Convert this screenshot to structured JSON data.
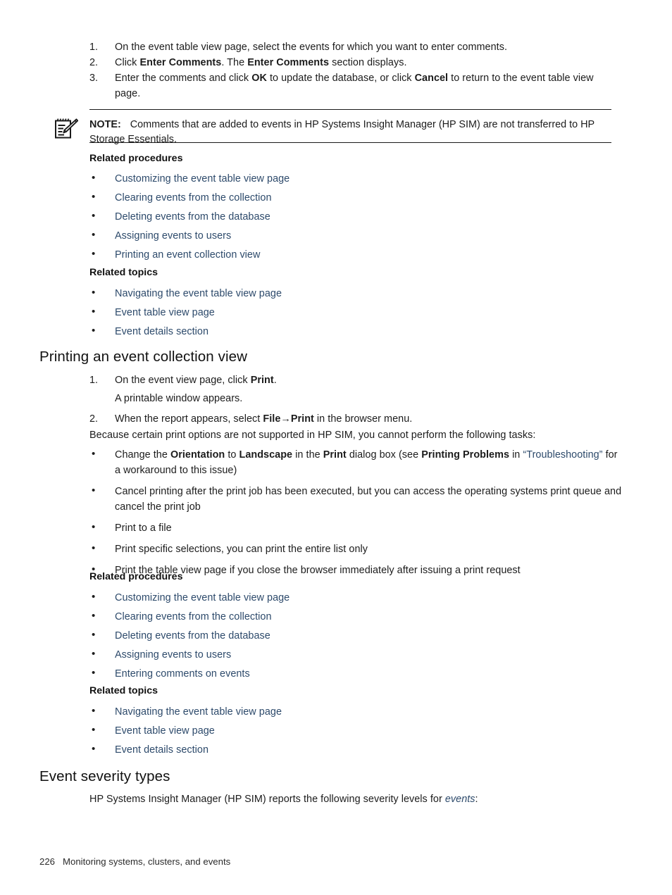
{
  "document": {
    "footer": {
      "page_number": "226",
      "chapter_title": "Monitoring systems, clusters, and events"
    }
  },
  "comments_steps": {
    "items": [
      {
        "num": "1.",
        "text": "On the event table view page, select the events for which you want to enter comments."
      },
      {
        "num": "2.",
        "text_parts": "Click Enter Comments. The Enter Comments section displays."
      },
      {
        "num": "3.",
        "text_parts": "Enter the comments and click OK to update the database, or click Cancel to return to the event table view page."
      }
    ],
    "step1": "On the event table view page, select the events for which you want to enter comments.",
    "step2_a": "Click ",
    "step2_b": "Enter Comments",
    "step2_c": ". The ",
    "step2_d": "Enter Comments",
    "step2_e": " section displays.",
    "step3_a": "Enter the comments and click ",
    "step3_b": "OK",
    "step3_c": " to update the database, or click ",
    "step3_d": "Cancel",
    "step3_e": " to return to the event table view page."
  },
  "note": {
    "icon": "note-pencil-icon",
    "label": "NOTE:",
    "text": "Comments that are added to events in HP Systems Insight Manager (HP SIM) are not transferred to HP Storage Essentials."
  },
  "related_1": {
    "procedures_heading": "Related procedures",
    "procedures": [
      "Customizing the event table view page",
      "Clearing events from the collection",
      "Deleting events from the database",
      "Assigning events to users",
      "Printing an event collection view"
    ],
    "topics_heading": "Related topics",
    "topics": [
      "Navigating the event table view page",
      "Event table view page",
      "Event details section"
    ]
  },
  "printing_section": {
    "heading": "Printing an event collection view",
    "step1_a": "On the event view page, click ",
    "step1_b": "Print",
    "step1_c": ".",
    "step1_note": "A printable window appears.",
    "step2_a": "When the report appears, select ",
    "step2_b": "File",
    "step2_arrow": "→",
    "step2_c": "Print",
    "step2_d": " in the browser menu.",
    "step_numbers": {
      "one": "1.",
      "two": "2."
    },
    "intro": "Because certain print options are not supported in HP SIM, you cannot perform the following tasks:",
    "limits": {
      "b1_a": "Change the ",
      "b1_b": "Orientation",
      "b1_c": " to ",
      "b1_d": "Landscape",
      "b1_e": " in the ",
      "b1_f": "Print",
      "b1_g": " dialog box (see ",
      "b1_h": "Printing Problems",
      "b1_i": " in ",
      "b1_link": "“Troubleshooting”",
      "b1_j": " for a workaround to this issue)",
      "b2": "Cancel printing after the print job has been executed, but you can access the operating systems print queue and cancel the print job",
      "b3": "Print to a file",
      "b4": "Print specific selections, you can print the entire list only",
      "b5": "Print the table view page if you close the browser immediately after issuing a print request"
    }
  },
  "related_2": {
    "procedures_heading": "Related procedures",
    "procedures": [
      "Customizing the event table view page",
      "Clearing events from the collection",
      "Deleting events from the database",
      "Assigning events to users",
      "Entering comments on events"
    ],
    "topics_heading": "Related topics",
    "topics": [
      "Navigating the event table view page",
      "Event table view page",
      "Event details section"
    ]
  },
  "severity_section": {
    "heading": "Event severity types",
    "intro_a": "HP Systems Insight Manager (HP SIM) reports the following severity levels for ",
    "intro_link": "events",
    "intro_b": ":"
  },
  "bullet_glyph": "•",
  "colors": {
    "link": "#2d4a6b",
    "text": "#1c1c1c"
  }
}
